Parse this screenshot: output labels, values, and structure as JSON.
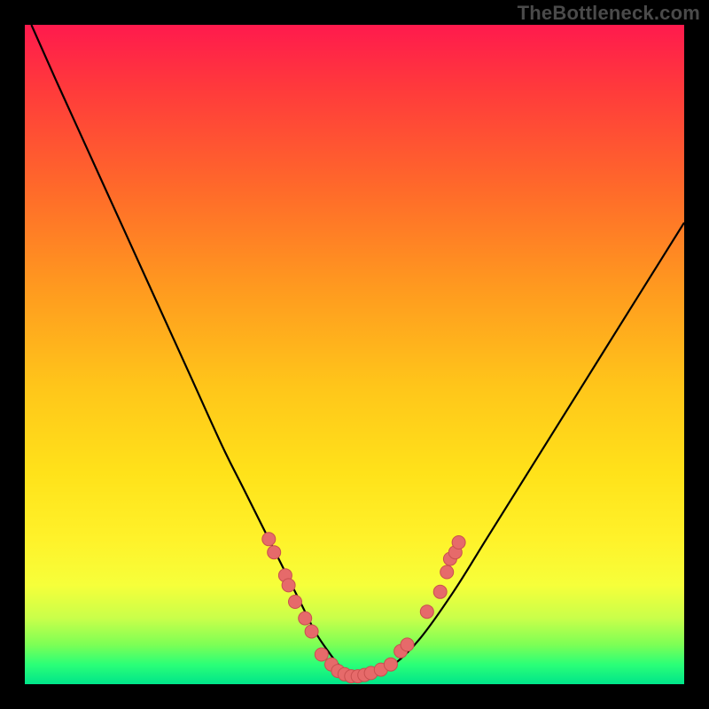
{
  "watermark": "TheBottleneck.com",
  "colors": {
    "frame": "#000000",
    "curve": "#000000",
    "dot_fill": "#e66a6a",
    "dot_stroke": "#c94f4f"
  },
  "chart_data": {
    "type": "line",
    "title": "",
    "xlabel": "",
    "ylabel": "",
    "xlim": [
      0,
      100
    ],
    "ylim": [
      0,
      100
    ],
    "grid": false,
    "legend": false,
    "series": [
      {
        "name": "bottleneck-curve",
        "x": [
          1,
          5,
          10,
          15,
          20,
          25,
          30,
          33,
          36,
          39,
          42,
          44,
          46,
          48,
          50,
          53,
          56,
          60,
          65,
          70,
          75,
          80,
          85,
          90,
          95,
          100
        ],
        "y": [
          100,
          91,
          80,
          69,
          58,
          47,
          36,
          30,
          24,
          18,
          12,
          8,
          5,
          2.5,
          1.2,
          1.5,
          3,
          7,
          14,
          22,
          30,
          38,
          46,
          54,
          62,
          70
        ]
      }
    ],
    "points": [
      {
        "name": "left-cluster",
        "x": 37.0,
        "y": 22.0
      },
      {
        "name": "left-cluster",
        "x": 37.8,
        "y": 20.0
      },
      {
        "name": "left-cluster",
        "x": 39.5,
        "y": 16.5
      },
      {
        "name": "left-cluster",
        "x": 40.0,
        "y": 15.0
      },
      {
        "name": "left-cluster",
        "x": 41.0,
        "y": 12.5
      },
      {
        "name": "left-cluster",
        "x": 42.5,
        "y": 10.0
      },
      {
        "name": "left-cluster",
        "x": 43.5,
        "y": 8.0
      },
      {
        "name": "trough",
        "x": 45.0,
        "y": 4.5
      },
      {
        "name": "trough",
        "x": 46.5,
        "y": 3.0
      },
      {
        "name": "trough",
        "x": 47.5,
        "y": 2.0
      },
      {
        "name": "trough",
        "x": 48.5,
        "y": 1.5
      },
      {
        "name": "trough",
        "x": 49.5,
        "y": 1.2
      },
      {
        "name": "trough",
        "x": 50.5,
        "y": 1.2
      },
      {
        "name": "trough",
        "x": 51.5,
        "y": 1.4
      },
      {
        "name": "trough",
        "x": 52.5,
        "y": 1.7
      },
      {
        "name": "trough",
        "x": 54.0,
        "y": 2.2
      },
      {
        "name": "trough",
        "x": 55.5,
        "y": 3.0
      },
      {
        "name": "right-cluster",
        "x": 57.0,
        "y": 5.0
      },
      {
        "name": "right-cluster",
        "x": 58.0,
        "y": 6.0
      },
      {
        "name": "right-cluster",
        "x": 61.0,
        "y": 11.0
      },
      {
        "name": "right-cluster",
        "x": 63.0,
        "y": 14.0
      },
      {
        "name": "right-cluster",
        "x": 64.0,
        "y": 17.0
      },
      {
        "name": "right-cluster",
        "x": 64.5,
        "y": 19.0
      },
      {
        "name": "right-cluster",
        "x": 65.3,
        "y": 20.0
      },
      {
        "name": "right-cluster",
        "x": 65.8,
        "y": 21.5
      }
    ]
  }
}
